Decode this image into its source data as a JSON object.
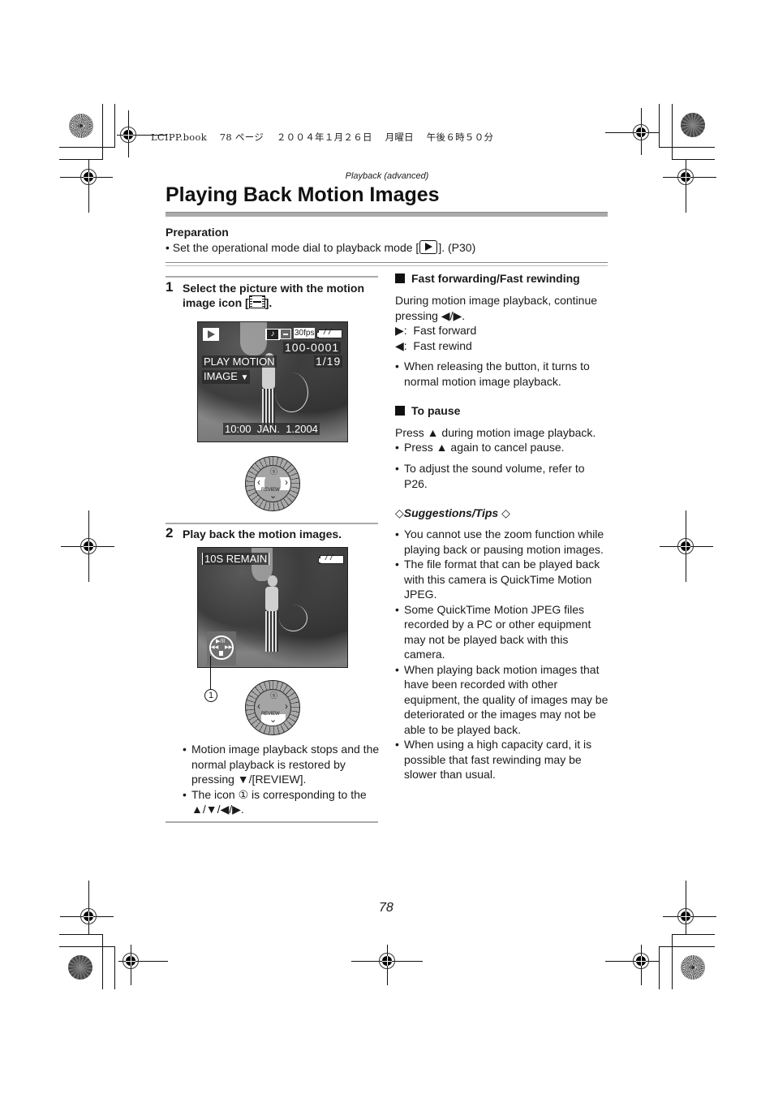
{
  "slug": "LCIPP.book　 78 ページ　 ２００４年１月２６日　 月曜日　 午後６時５０分",
  "header": {
    "section": "Playback (advanced)",
    "title": "Playing Back Motion Images"
  },
  "preparation": {
    "heading": "Preparation",
    "text_before": "• Set the operational mode dial to playback mode [",
    "icon": "play-mode-icon",
    "text_after": "]. (P30)"
  },
  "step1": {
    "number": "1",
    "line1": "Select the picture with the motion",
    "line2_before": "image icon [",
    "line2_icon": "motion-image-icon",
    "line2_after": "].",
    "lcd": {
      "mode_icon": "play-icon",
      "audio_icon": "audio-icon",
      "motion_icon": "motion-image-icon",
      "fps": "30fps",
      "battery_icon": "battery-icon",
      "file_number": "100-0001",
      "count": "1/19",
      "menu_line1": "PLAY MOTION",
      "menu_line2": "IMAGE",
      "menu_arrow": "▼",
      "datetime": "10:00  JAN.  1.2004"
    },
    "dial": {
      "up": "timer-icon",
      "left": "‹",
      "right": "›",
      "down": "⌄",
      "label": "REVIEW",
      "highlight": "left-right"
    }
  },
  "step2": {
    "number": "2",
    "text": "Play back the motion images.",
    "lcd": {
      "remain": "10S REMAIN",
      "battery_icon": "battery-icon",
      "control_icon": {
        "top": "▶/II",
        "left": "◀◀",
        "right": "▶▶",
        "bottom": "stop"
      }
    },
    "callout": "1",
    "dial": {
      "up": "timer-icon",
      "left": "‹",
      "right": "›",
      "down": "⌄",
      "label": "REVIEW",
      "highlight": "down"
    },
    "notes": [
      "Motion image playback stops and the normal playback is restored by pressing ▼/[REVIEW].",
      "The icon ① is corresponding to the ▲/▼/◀/▶."
    ]
  },
  "fast": {
    "heading": "Fast forwarding/Fast rewinding",
    "line1": "During motion image playback, continue",
    "line2": "pressing ◀/▶.",
    "line3": "▶:  Fast forward",
    "line4": "◀:  Fast rewind",
    "bullets": [
      "When releasing the button, it turns to normal motion image playback."
    ]
  },
  "pause": {
    "heading": "To pause",
    "line1": "Press ▲ during motion image playback.",
    "bullets": [
      "Press ▲ again to cancel pause."
    ],
    "bullets2": [
      "To adjust the sound volume, refer to P26."
    ]
  },
  "tips": {
    "heading": "Suggestions/Tips",
    "diamond": "◇",
    "items": [
      "You cannot use the zoom function while playing back or pausing motion images.",
      "The file format that can be played back with this camera is QuickTime Motion JPEG.",
      "Some QuickTime Motion JPEG files recorded by a PC or other equipment may not be played back with this camera.",
      "When playing back motion images that have been recorded with other equipment, the quality of images may be deteriorated or the images may not be able to be played back.",
      "When using a high capacity card, it is possible that fast rewinding may be slower than usual."
    ]
  },
  "page_number": "78"
}
